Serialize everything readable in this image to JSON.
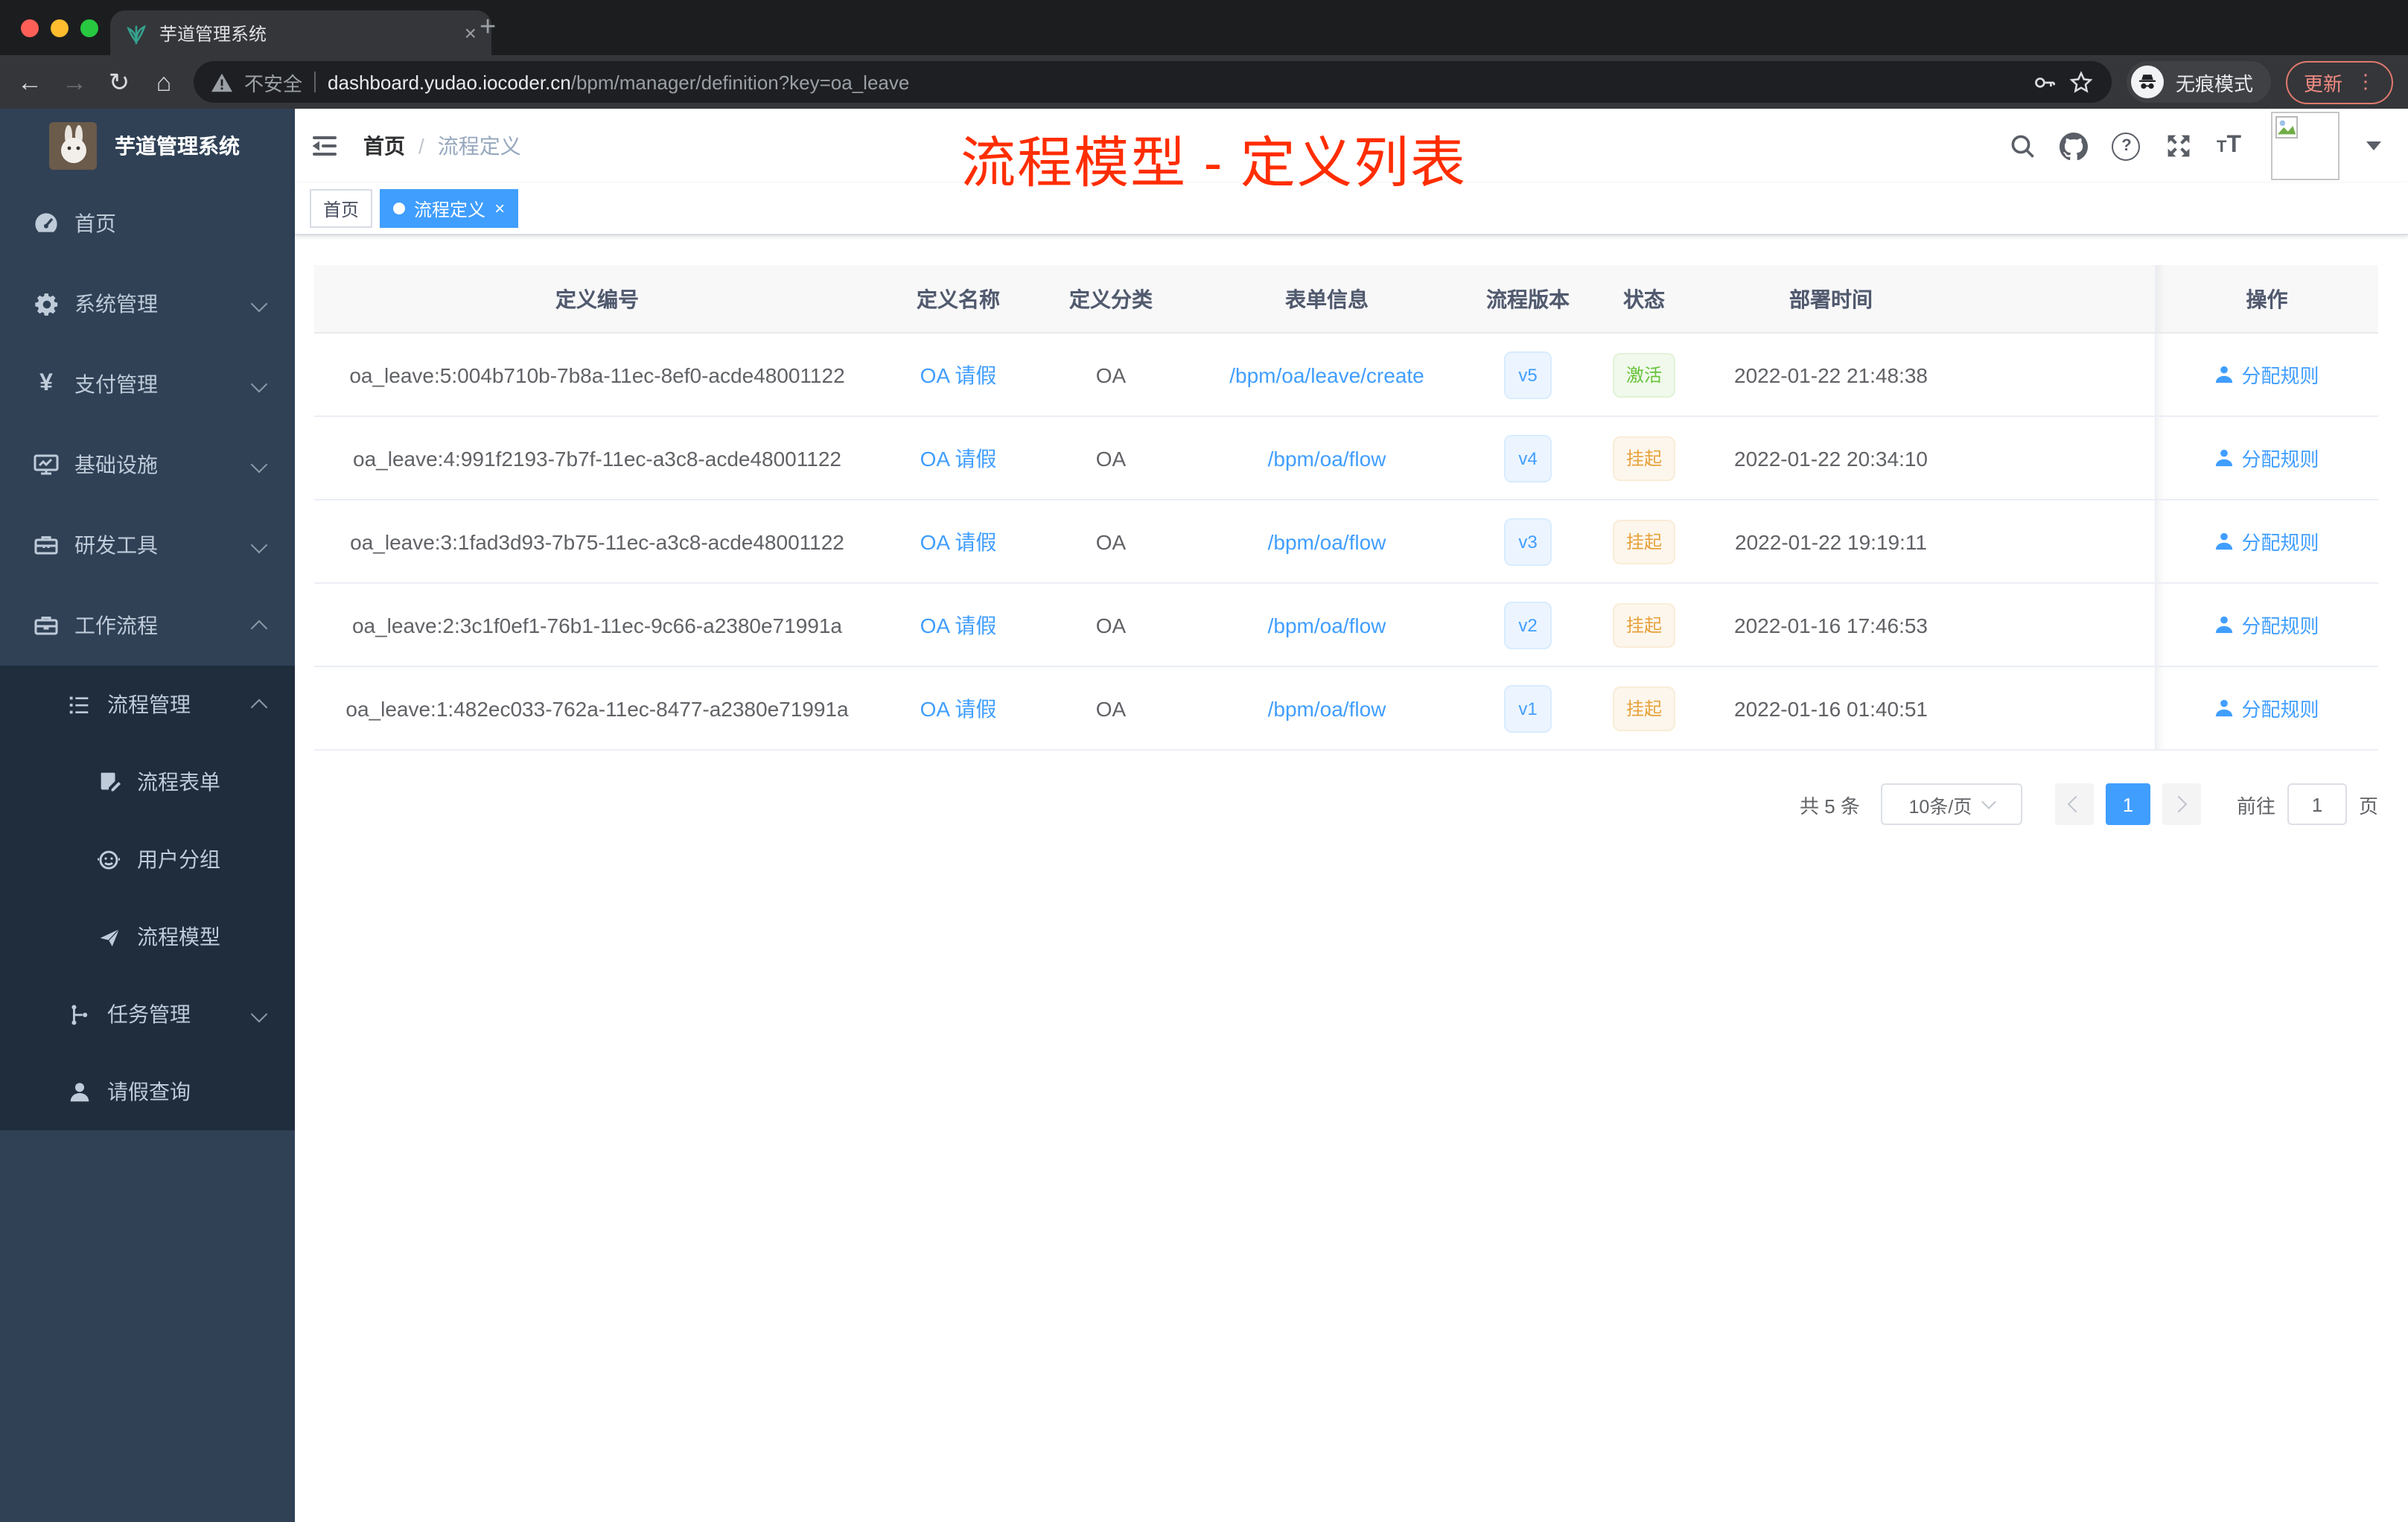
{
  "browser": {
    "tab_title": "芋道管理系统",
    "new_tab": "+",
    "back": "←",
    "forward": "→",
    "reload": "↻",
    "home": "⌂",
    "security_label": "不安全",
    "url_domain": "dashboard.yudao.iocoder.cn",
    "url_path": "/bpm/manager/definition?key=oa_leave",
    "incognito_label": "无痕模式",
    "update_label": "更新",
    "more_dots": "⋮",
    "close_tab": "×"
  },
  "sidebar": {
    "logo_title": "芋道管理系统",
    "items": [
      {
        "label": "首页"
      },
      {
        "label": "系统管理"
      },
      {
        "label": "支付管理"
      },
      {
        "label": "基础设施"
      },
      {
        "label": "研发工具"
      },
      {
        "label": "工作流程"
      },
      {
        "label": "流程管理"
      },
      {
        "label": "流程表单"
      },
      {
        "label": "用户分组"
      },
      {
        "label": "流程模型"
      },
      {
        "label": "任务管理"
      },
      {
        "label": "请假查询"
      }
    ],
    "yen_glyph": "¥"
  },
  "header": {
    "breadcrumb_home": "首页",
    "breadcrumb_sep": "/",
    "breadcrumb_current": "流程定义",
    "annotation": "流程模型 - 定义列表"
  },
  "tags": {
    "home": "首页",
    "current": "流程定义",
    "close": "×"
  },
  "table": {
    "columns": [
      "定义编号",
      "定义名称",
      "定义分类",
      "表单信息",
      "流程版本",
      "状态",
      "部署时间",
      "操作"
    ],
    "rows": [
      {
        "id": "oa_leave:5:004b710b-7b8a-11ec-8ef0-acde48001122",
        "name": "OA 请假",
        "category": "OA",
        "form": "/bpm/oa/leave/create",
        "version": "v5",
        "status": "激活",
        "time": "2022-01-22 21:48:38",
        "action": "分配规则"
      },
      {
        "id": "oa_leave:4:991f2193-7b7f-11ec-a3c8-acde48001122",
        "name": "OA 请假",
        "category": "OA",
        "form": "/bpm/oa/flow",
        "version": "v4",
        "status": "挂起",
        "time": "2022-01-22 20:34:10",
        "action": "分配规则"
      },
      {
        "id": "oa_leave:3:1fad3d93-7b75-11ec-a3c8-acde48001122",
        "name": "OA 请假",
        "category": "OA",
        "form": "/bpm/oa/flow",
        "version": "v3",
        "status": "挂起",
        "time": "2022-01-22 19:19:11",
        "action": "分配规则"
      },
      {
        "id": "oa_leave:2:3c1f0ef1-76b1-11ec-9c66-a2380e71991a",
        "name": "OA 请假",
        "category": "OA",
        "form": "/bpm/oa/flow",
        "version": "v2",
        "status": "挂起",
        "time": "2022-01-16 17:46:53",
        "action": "分配规则"
      },
      {
        "id": "oa_leave:1:482ec033-762a-11ec-8477-a2380e71991a",
        "name": "OA 请假",
        "category": "OA",
        "form": "/bpm/oa/flow",
        "version": "v1",
        "status": "挂起",
        "time": "2022-01-16 01:40:51",
        "action": "分配规则"
      }
    ]
  },
  "pagination": {
    "total": "共 5 条",
    "page_size": "10条/页",
    "current_page": "1",
    "goto_label": "前往",
    "goto_value": "1",
    "page_unit": "页"
  },
  "colors": {
    "accent": "#409eff",
    "success": "#67c23a",
    "warning": "#e6a23c",
    "annotation_red": "#ff2d00",
    "sidebar_bg": "#304156",
    "submenu_bg": "#1f2d3d"
  }
}
